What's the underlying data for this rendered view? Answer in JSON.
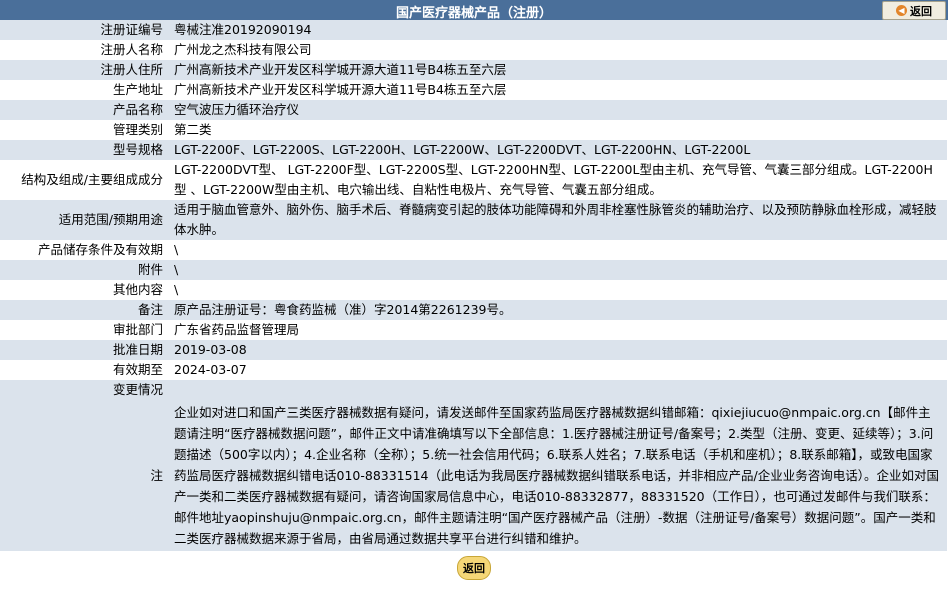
{
  "header": {
    "title": "国产医疗器械产品（注册）",
    "back_label": "返回"
  },
  "fields": [
    {
      "label": "注册证编号",
      "value": "粤械注准20192090194"
    },
    {
      "label": "注册人名称",
      "value": "广州龙之杰科技有限公司"
    },
    {
      "label": "注册人住所",
      "value": "广州高新技术产业开发区科学城开源大道11号B4栋五至六层"
    },
    {
      "label": "生产地址",
      "value": "广州高新技术产业开发区科学城开源大道11号B4栋五至六层"
    },
    {
      "label": "产品名称",
      "value": "空气波压力循环治疗仪"
    },
    {
      "label": "管理类别",
      "value": "第二类"
    },
    {
      "label": "型号规格",
      "value": "LGT-2200F、LGT-2200S、LGT-2200H、LGT-2200W、LGT-2200DVT、LGT-2200HN、LGT-2200L"
    },
    {
      "label": "结构及组成/主要组成成分",
      "value": "LGT-2200DVT型、 LGT-2200F型、LGT-2200S型、LGT-2200HN型、LGT-2200L型由主机、充气导管、气囊三部分组成。LGT-2200H型 、LGT-2200W型由主机、电穴输出线、自粘性电极片、充气导管、气囊五部分组成。"
    },
    {
      "label": "适用范围/预期用途",
      "value": "适用于脑血管意外、脑外伤、脑手术后、脊髓病变引起的肢体功能障碍和外周非栓塞性脉管炎的辅助治疗、以及预防静脉血栓形成，减轻肢体水肿。"
    },
    {
      "label": "产品储存条件及有效期",
      "value": "\\"
    },
    {
      "label": "附件",
      "value": "\\"
    },
    {
      "label": "其他内容",
      "value": "\\"
    },
    {
      "label": "备注",
      "value": "原产品注册证号：粤食药监械（准）字2014第2261239号。"
    },
    {
      "label": "审批部门",
      "value": "广东省药品监督管理局"
    },
    {
      "label": "批准日期",
      "value": "2019-03-08"
    },
    {
      "label": "有效期至",
      "value": "2024-03-07"
    },
    {
      "label": "变更情况",
      "value": ""
    }
  ],
  "note": {
    "label": "注",
    "text": "企业如对进口和国产三类医疗器械数据有疑问，请发送邮件至国家药监局医疗器械数据纠错邮箱：qixiejiucuo@nmpaic.org.cn【邮件主题请注明“医疗器械数据问题”，邮件正文中请准确填写以下全部信息：1.医疗器械注册证号/备案号；2.类型（注册、变更、延续等）；3.问题描述（500字以内）；4.企业名称（全称）；5.统一社会信用代码；6.联系人姓名；7.联系电话（手机和座机）；8.联系邮箱】，或致电国家药监局医疗器械数据纠错电话010-88331514（此电话为我局医疗器械数据纠错联系电话，并非相应产品/企业业务咨询电话）。企业如对国产一类和二类医疗器械数据有疑问，请咨询国家局信息中心，电话010-88332877，88331520（工作日），也可通过发邮件与我们联系：邮件地址yaopinshuju@nmpaic.org.cn，邮件主题请注明“国产医疗器械产品（注册）-数据（注册证号/备案号）数据问题”。国产一类和二类医疗器械数据来源于省局，由省局通过数据共享平台进行纠错和维护。"
  },
  "footer": {
    "back_label": "返回"
  },
  "colors": {
    "header_bg": "#4a6f9a",
    "row_shaded": "#dbe3ec",
    "row_plain": "#ffffff",
    "back_button": "#f5d777"
  }
}
